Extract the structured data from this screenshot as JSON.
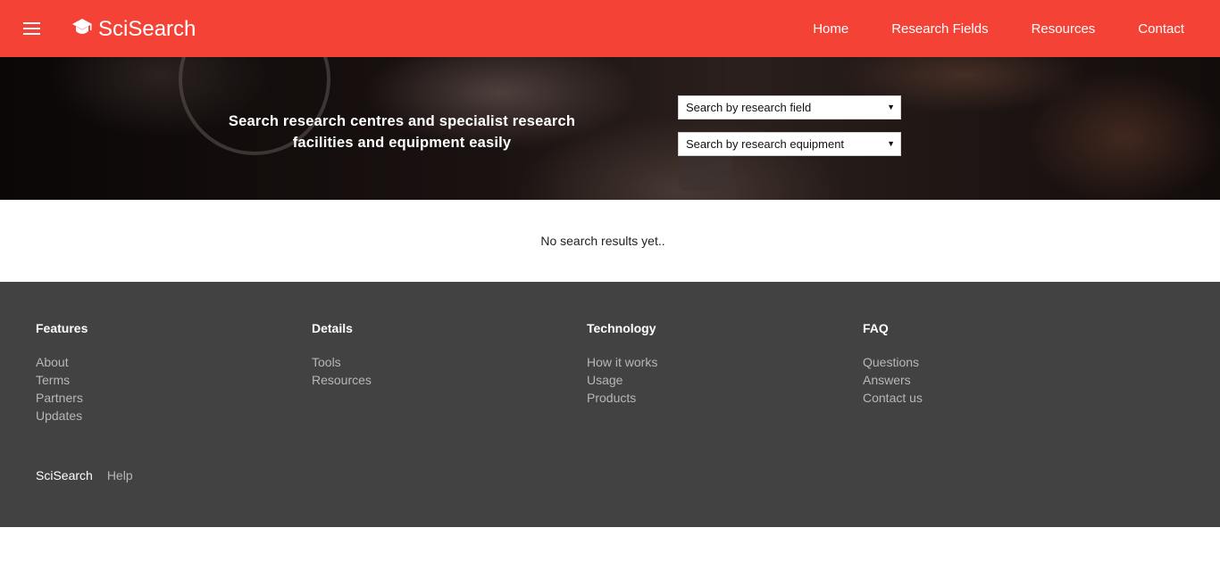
{
  "header": {
    "menu_icon": "hamburger-menu-icon",
    "brand_icon": "graduation-cap-icon",
    "brand": "SciSearch",
    "nav": [
      "Home",
      "Research Fields",
      "Resources",
      "Contact"
    ],
    "accent_color": "#f44336"
  },
  "hero": {
    "tagline_line1": "Search research centres and specialist research",
    "tagline_line2": "facilities and equipment easily",
    "select_field": "Search by research field",
    "select_equipment": "Search by research equipment"
  },
  "results": {
    "text": "No search results yet.."
  },
  "footer": {
    "background": "#424242",
    "columns": [
      {
        "heading": "Features",
        "links": [
          "About",
          "Terms",
          "Partners",
          "Updates"
        ]
      },
      {
        "heading": "Details",
        "links": [
          "Tools",
          "Resources"
        ]
      },
      {
        "heading": "Technology",
        "links": [
          "How it works",
          "Usage",
          "Products"
        ]
      },
      {
        "heading": "FAQ",
        "links": [
          "Questions",
          "Answers",
          "Contact us"
        ]
      }
    ],
    "bottom_brand": "SciSearch",
    "bottom_help": "Help"
  }
}
